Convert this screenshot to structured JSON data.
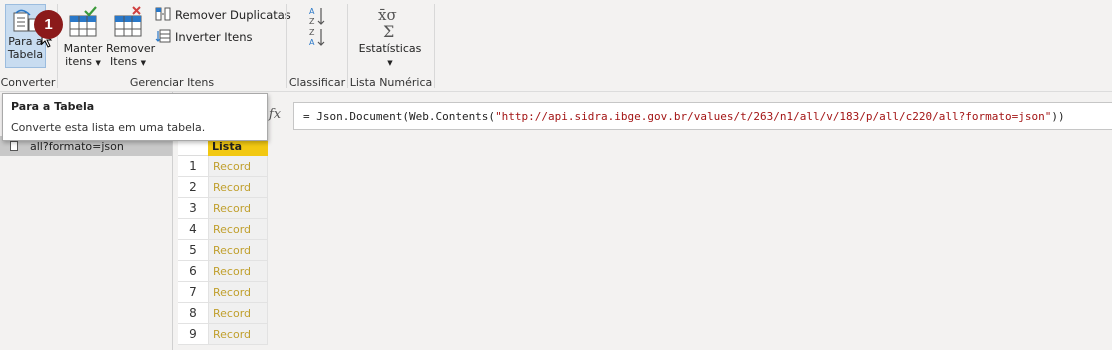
{
  "ribbon": {
    "converter": {
      "group_label": "Converter",
      "para_tabela": {
        "line1": "Para a",
        "line2": "Tabela",
        "icon": "list-to-table-icon"
      }
    },
    "gerenciar": {
      "group_label": "Gerenciar Itens",
      "manter": {
        "line1": "Manter",
        "line2": "itens"
      },
      "remover": {
        "line1": "Remover",
        "line2": "Itens"
      },
      "remover_duplicatas": "Remover Duplicatas",
      "inverter_itens": "Inverter Itens"
    },
    "classificar": {
      "group_label": "Classificar"
    },
    "lista_numerica": {
      "group_label": "Lista Numérica",
      "estatisticas": "Estatísticas"
    }
  },
  "tooltip": {
    "title": "Para a Tabela",
    "body": "Converte esta lista em uma tabela."
  },
  "badge": "1",
  "queries": [
    {
      "name": "all?formato=json"
    }
  ],
  "formula": {
    "fx": "fx",
    "prefix": "= Json.Document(Web.Contents(",
    "url": "\"http://api.sidra.ibge.gov.br/values/t/263/n1/all/v/183/p/all/c220/all?formato=json\"",
    "suffix": "))"
  },
  "grid": {
    "column": "Lista",
    "rows": [
      {
        "n": "1",
        "value": "Record"
      },
      {
        "n": "2",
        "value": "Record"
      },
      {
        "n": "3",
        "value": "Record"
      },
      {
        "n": "4",
        "value": "Record"
      },
      {
        "n": "5",
        "value": "Record"
      },
      {
        "n": "6",
        "value": "Record"
      },
      {
        "n": "7",
        "value": "Record"
      },
      {
        "n": "8",
        "value": "Record"
      },
      {
        "n": "9",
        "value": "Record"
      }
    ]
  },
  "colors": {
    "header_yellow": "#f2c811",
    "record_text": "#c09f2c",
    "badge": "#8b1a1a"
  }
}
